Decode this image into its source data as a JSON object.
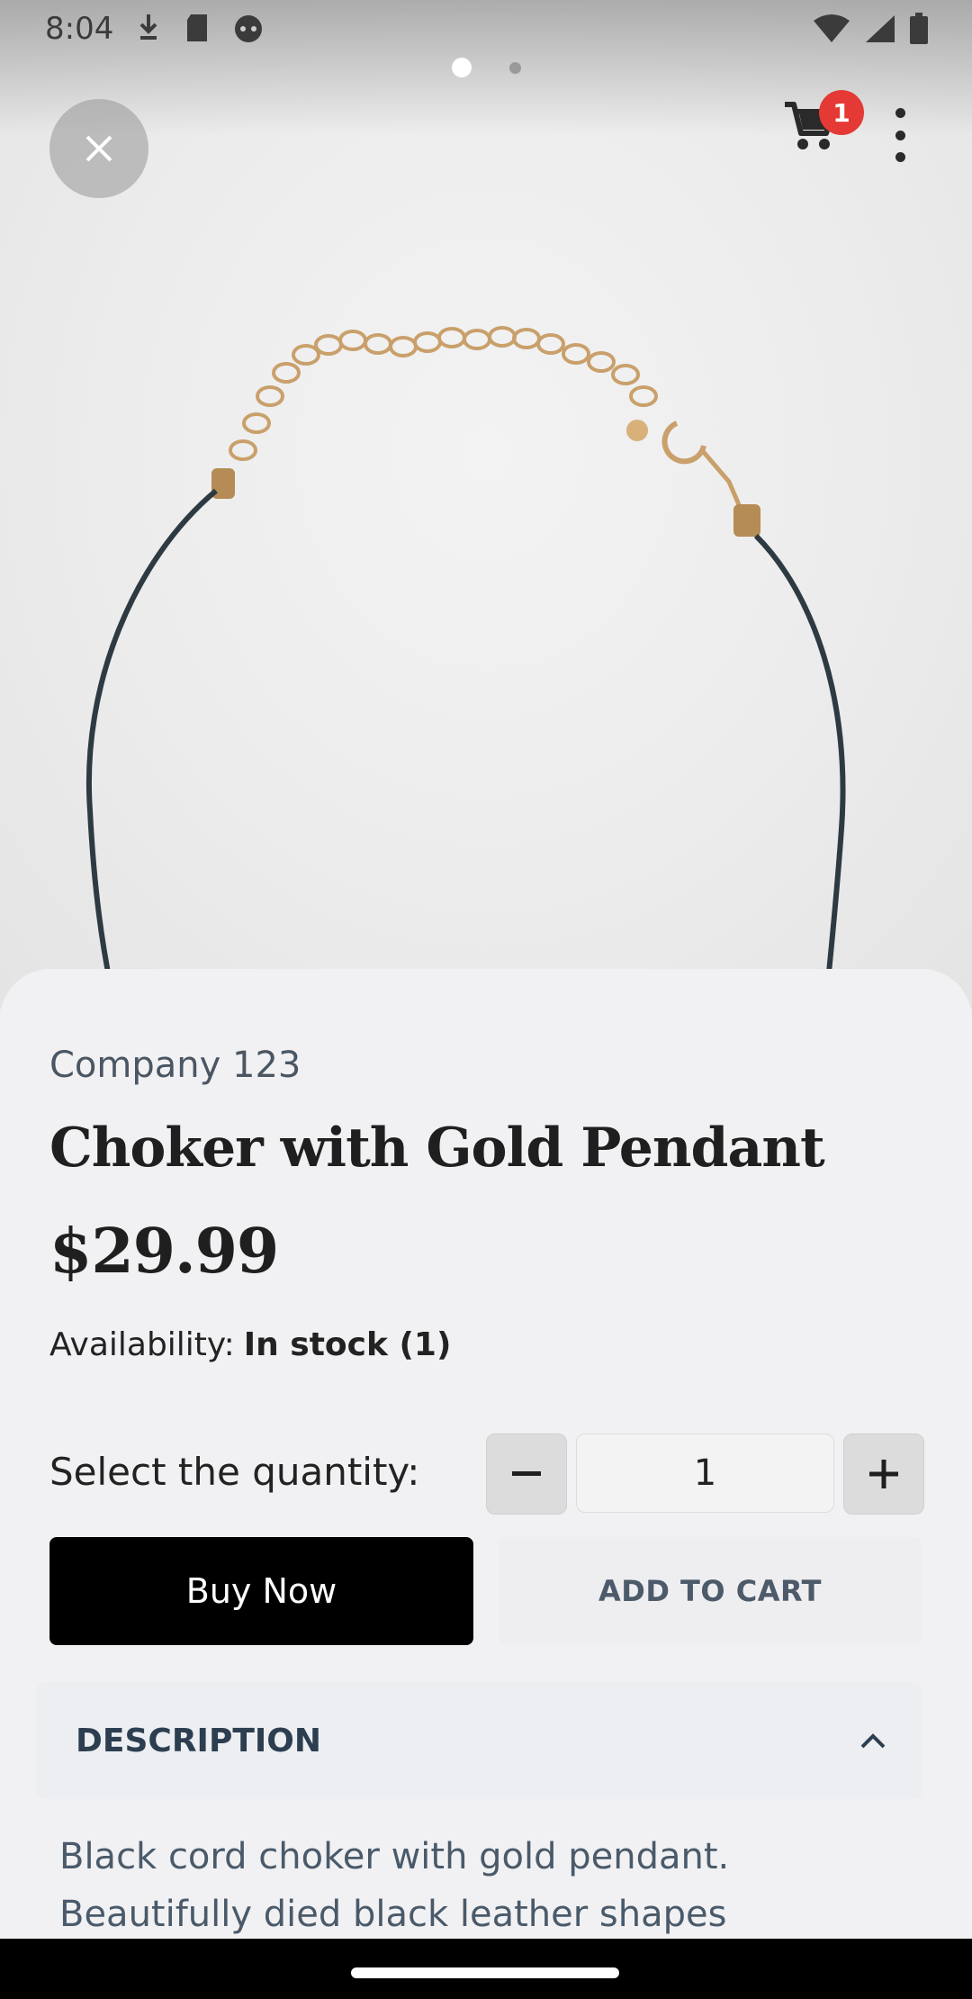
{
  "status_bar": {
    "time": "8:04",
    "left_icons": [
      "download-icon",
      "sd-card-icon",
      "face-icon"
    ],
    "right_icons": [
      "wifi-icon",
      "signal-icon",
      "battery-icon"
    ]
  },
  "carousel": {
    "total": 2,
    "active": 1
  },
  "top_actions": {
    "close_icon": "close-icon",
    "cart_icon": "cart-icon",
    "cart_count": "1",
    "more_icon": "more-vert-icon"
  },
  "product": {
    "brand": "Company 123",
    "title": "Choker with Gold Pendant",
    "price": "$29.99",
    "availability_label": "Availability:",
    "availability_value": "In stock  (1)"
  },
  "quantity": {
    "label": "Select the quantity:",
    "value": "1"
  },
  "actions": {
    "buy_now": "Buy Now",
    "add_to_cart": "ADD TO CART"
  },
  "description": {
    "title": "DESCRIPTION",
    "text": "Black cord choker with gold pendant. Beautifully died black leather shapes"
  },
  "colors": {
    "badge": "#e53935",
    "buy_button": "#000000",
    "sheet": "#f1f1f3"
  }
}
